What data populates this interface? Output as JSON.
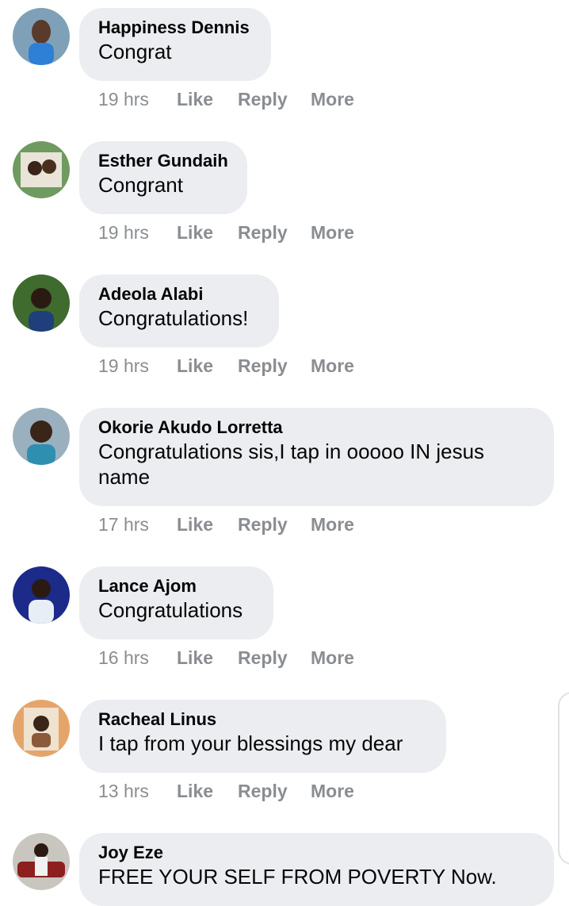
{
  "comments": [
    {
      "author": "Happiness Dennis",
      "text": "Congrat",
      "time": "19 hrs",
      "like": "Like",
      "reply": "Reply",
      "more": "More"
    },
    {
      "author": "Esther Gundaih",
      "text": "Congrant",
      "time": "19 hrs",
      "like": "Like",
      "reply": "Reply",
      "more": "More"
    },
    {
      "author": "Adeola Alabi",
      "text": "Congratulations!",
      "time": "19 hrs",
      "like": "Like",
      "reply": "Reply",
      "more": "More"
    },
    {
      "author": "Okorie Akudo Lorretta",
      "text": "Congratulations sis,I tap in ooooo IN jesus name",
      "time": "17 hrs",
      "like": "Like",
      "reply": "Reply",
      "more": "More"
    },
    {
      "author": "Lance Ajom",
      "text": "Congratulations",
      "time": "16 hrs",
      "like": "Like",
      "reply": "Reply",
      "more": "More"
    },
    {
      "author": "Racheal Linus",
      "text": "I tap from your blessings my dear",
      "time": "13 hrs",
      "like": "Like",
      "reply": "Reply",
      "more": "More"
    },
    {
      "author": "Joy Eze",
      "text": "FREE YOUR SELF FROM POVERTY Now.",
      "time": "",
      "like": "",
      "reply": "",
      "more": ""
    }
  ]
}
